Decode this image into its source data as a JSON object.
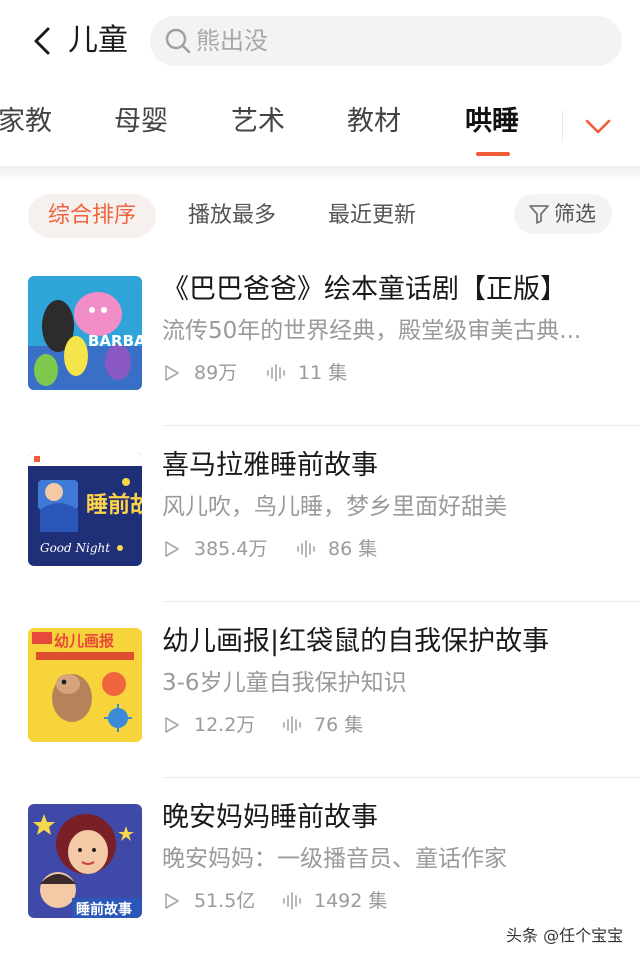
{
  "header": {
    "title": "儿童",
    "search_placeholder": "熊出没"
  },
  "tabs": [
    {
      "label": "家教",
      "active": false
    },
    {
      "label": "母婴",
      "active": false
    },
    {
      "label": "艺术",
      "active": false
    },
    {
      "label": "教材",
      "active": false
    },
    {
      "label": "哄睡",
      "active": true
    }
  ],
  "sort": {
    "options": [
      "综合排序",
      "播放最多",
      "最近更新"
    ],
    "selected": "综合排序",
    "filter_label": "筛选"
  },
  "items": [
    {
      "title": "《巴巴爸爸》绘本童话剧【正版】",
      "desc": "流传50年的世界经典，殿堂级审美古典...",
      "plays": "89万",
      "episodes": "11 集",
      "cover_text": "BARBA"
    },
    {
      "title": "喜马拉雅睡前故事",
      "desc": "风儿吹，鸟儿睡，梦乡里面好甜美",
      "plays": "385.4万",
      "episodes": "86 集",
      "cover_text": "睡前故事"
    },
    {
      "title": "幼儿画报|红袋鼠的自我保护故事",
      "desc": "3-6岁儿童自我保护知识",
      "plays": "12.2万",
      "episodes": "76 集",
      "cover_text": "幼儿画报"
    },
    {
      "title": "晚安妈妈睡前故事",
      "desc": "晚安妈妈：一级播音员、童话作家",
      "plays": "51.5亿",
      "episodes": "1492 集",
      "cover_text": "睡前故事"
    }
  ],
  "watermark": "头条 @任个宝宝",
  "colors": {
    "accent": "#f0653e",
    "tab_underline": "#f15c3b",
    "muted_text": "#9a9a9a"
  },
  "icons": [
    "back-icon",
    "search-icon",
    "chevron-down-icon",
    "filter-icon",
    "play-icon",
    "audio-wave-icon"
  ]
}
